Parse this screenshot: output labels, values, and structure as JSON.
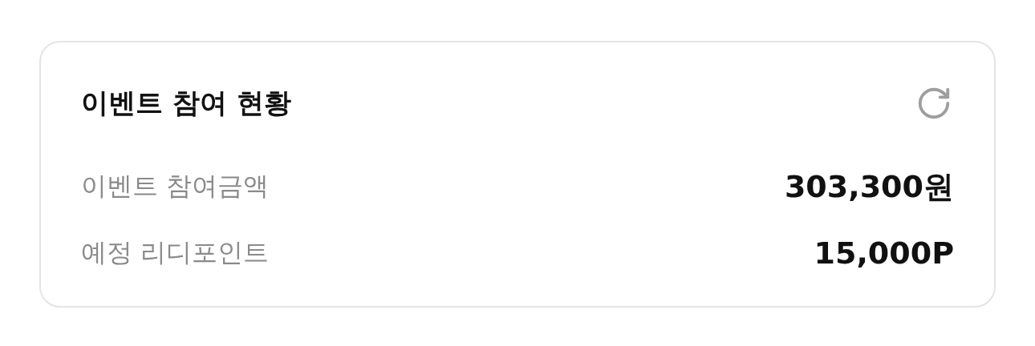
{
  "card": {
    "title": "이벤트 참여 현황",
    "rows": [
      {
        "label": "이벤트 참여금액",
        "value": "303,300원"
      },
      {
        "label": "예정 리디포인트",
        "value": "15,000P"
      }
    ]
  }
}
